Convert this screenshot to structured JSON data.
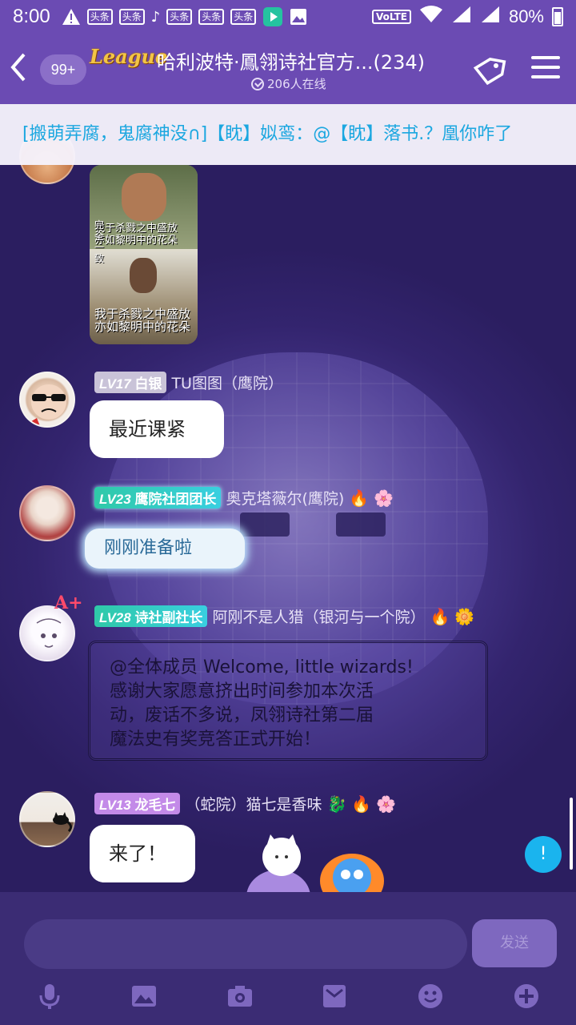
{
  "status_bar": {
    "time": "8:00",
    "news_badge": "头条",
    "volte": "VoLTE",
    "battery": "80%"
  },
  "header": {
    "back_icon": "chevron-left-icon",
    "unread_count": "99+",
    "brand": "League",
    "title": "哈利波特·鳳翎诗社官方...(234)",
    "online": "206人在线"
  },
  "announcement": "[搬萌弄腐，鬼腐神没∩]【眈】姒鸾：@【眈】落书.？凰你咋了",
  "messages": [
    {
      "type": "image",
      "caption_top": "我于杀戮之中盛放\n亦如黎明中的花朵",
      "side_text": "完\n全\n一\n致",
      "caption_bottom": "我于杀戮之中盛放\n亦如黎明中的花朵"
    },
    {
      "level": "LV17",
      "title": "白银",
      "name": "TU图图（鹰院）",
      "text": "最近课紧",
      "level_color": "#c9c3d8"
    },
    {
      "level": "LV23",
      "title": "鹰院社团团长",
      "name": "奥克塔薇尔(鹰院)",
      "text": "刚刚准备啦",
      "level_color": "#3ad3c0"
    },
    {
      "level": "LV28",
      "title": "诗社副社长",
      "name": "阿刚不是人猎（银河与一个院）",
      "badge": "A+",
      "text_lines": [
        "@全体成员 Welcome, little wizards!",
        "感谢大家愿意挤出时间参加本次活",
        "动，废话不多说，凤翎诗社第二届",
        "魔法史有奖竞答正式开始！"
      ],
      "level_color": "#3ad3c0"
    },
    {
      "level": "LV13",
      "title": "龙毛七",
      "name": "（蛇院）猫七是香味",
      "text": "来了！",
      "level_color": "#c38ae8"
    }
  ],
  "floating_badge": "!",
  "input": {
    "placeholder": "",
    "send_label": "发送"
  },
  "toolbar": [
    "mic-icon",
    "image-icon",
    "camera-icon",
    "envelope-icon",
    "smile-icon",
    "plus-icon"
  ]
}
